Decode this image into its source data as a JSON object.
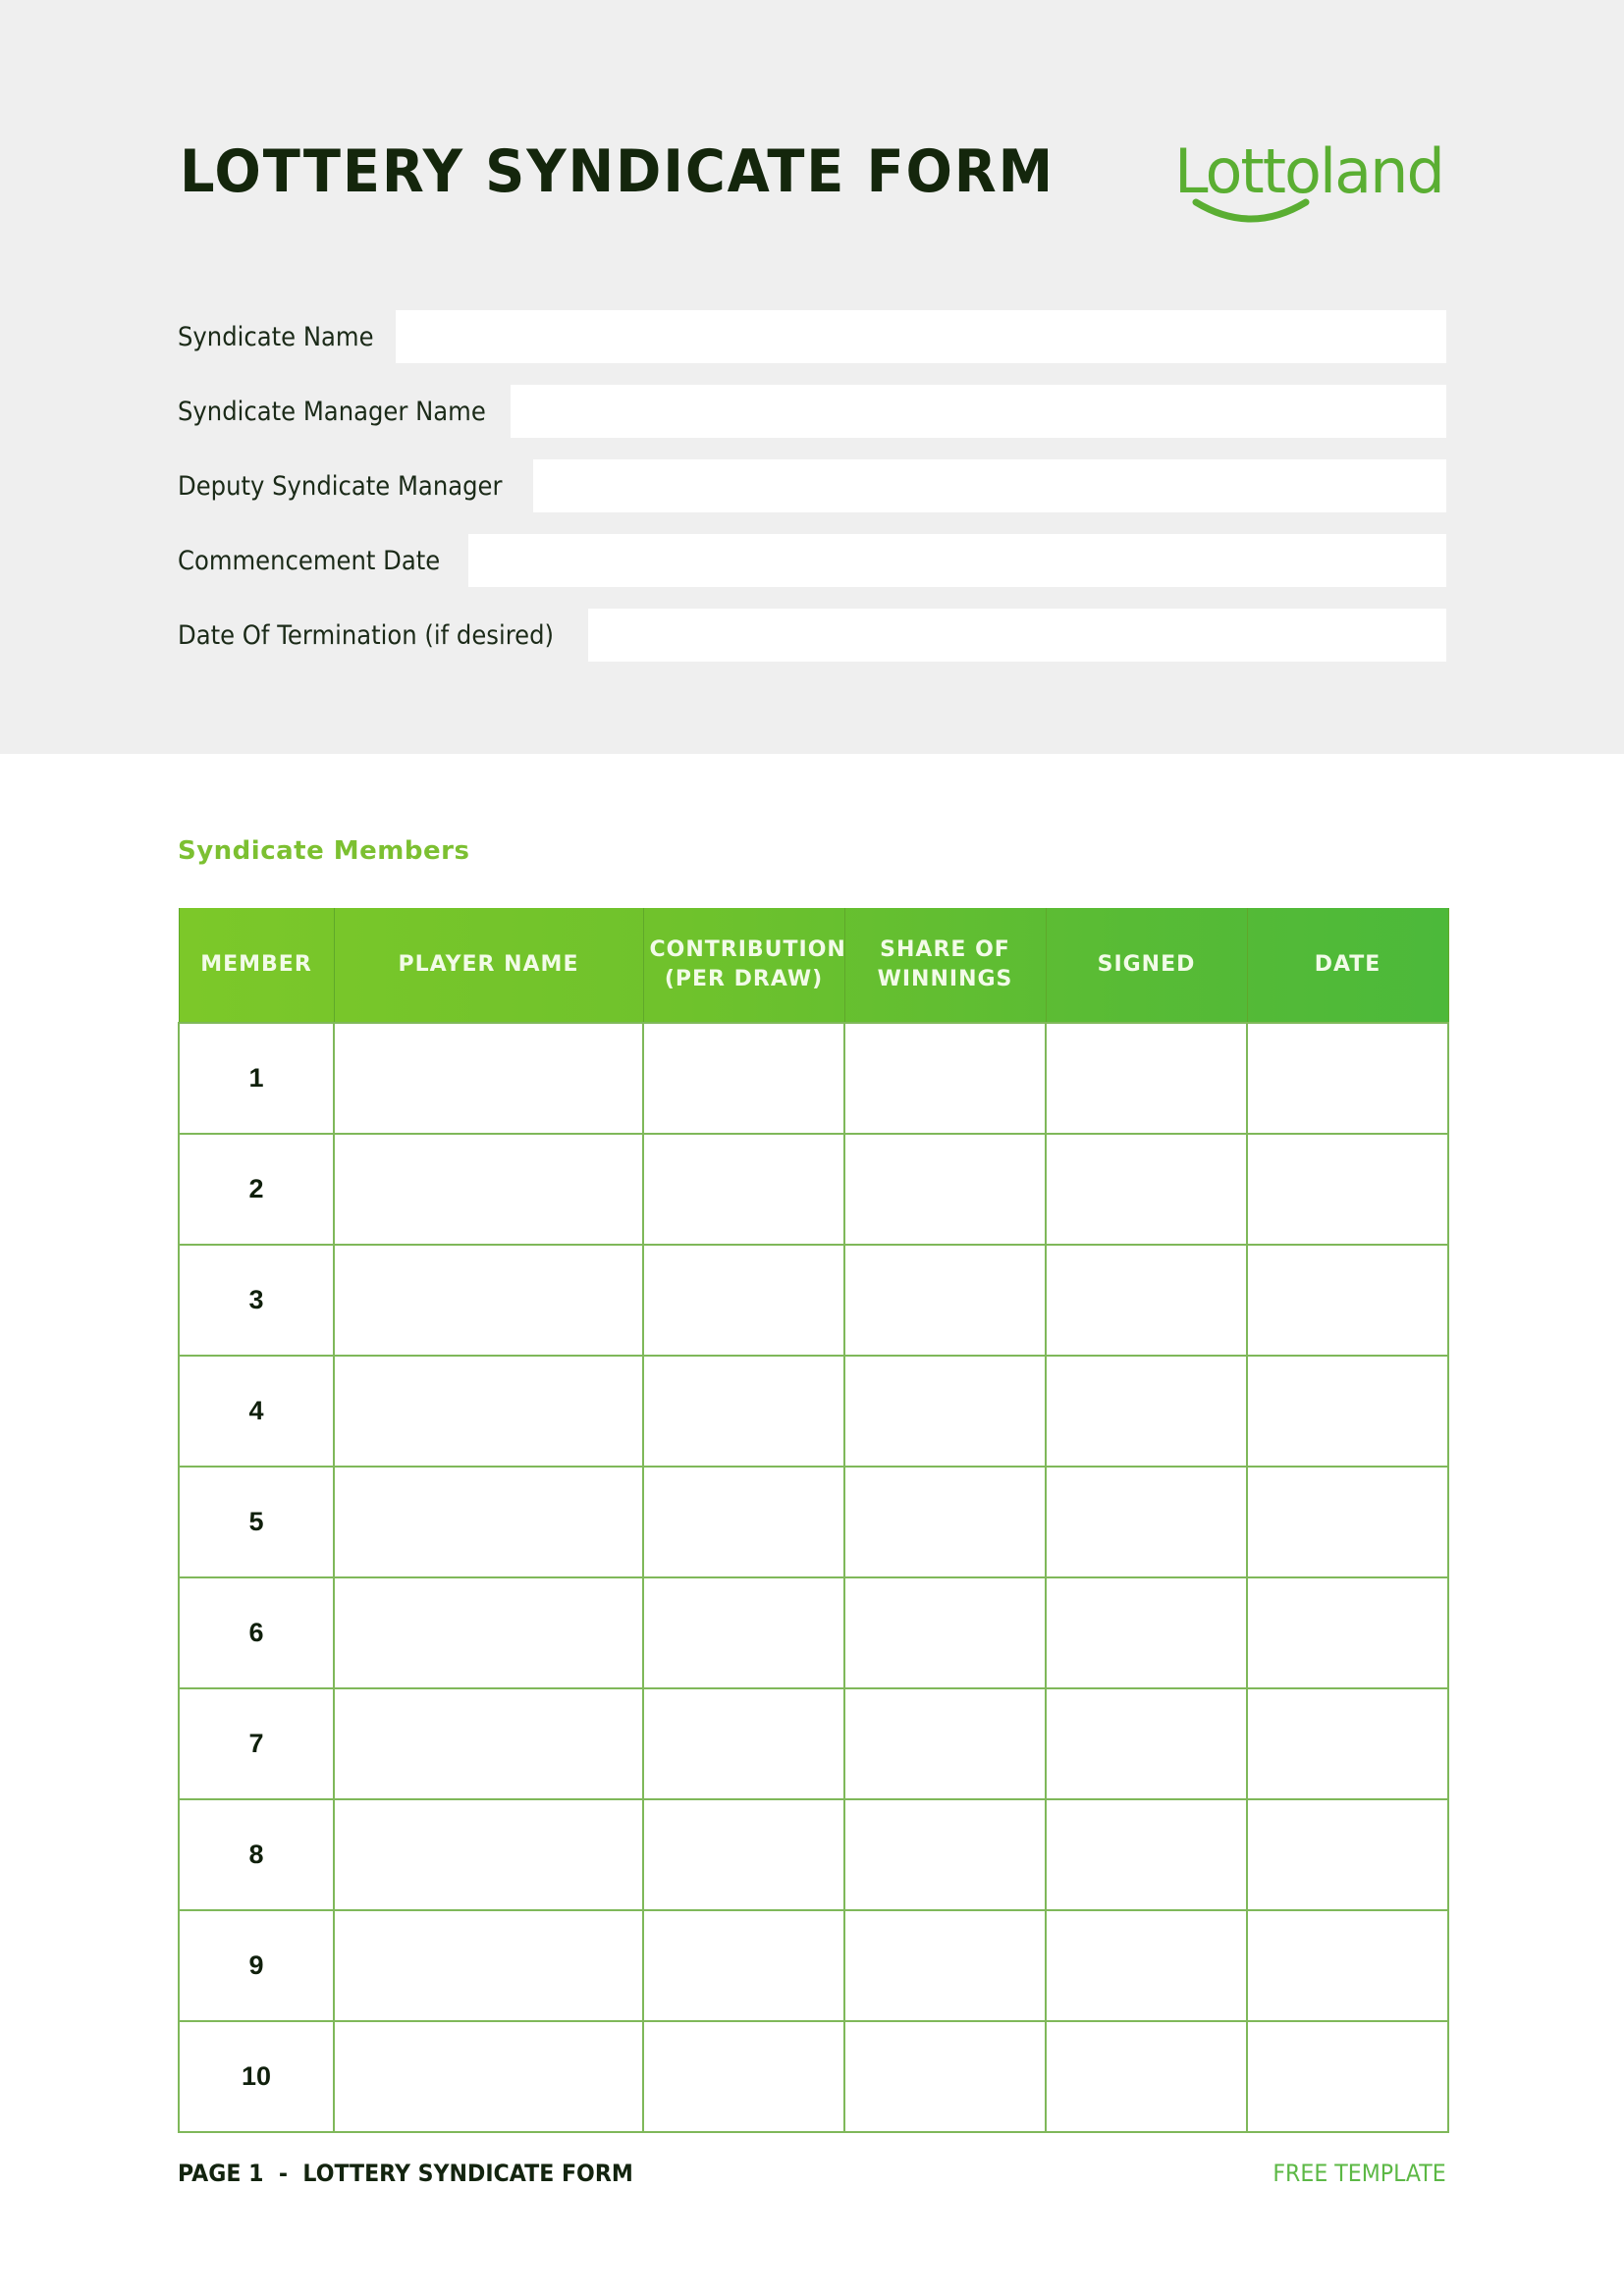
{
  "header": {
    "title": "LOTTERY SYNDICATE FORM",
    "brand": "Lottoland",
    "brand_color": "#5aae32"
  },
  "fields": [
    {
      "label": "Syndicate Name",
      "value": "",
      "placeholder": ""
    },
    {
      "label": "Syndicate Manager Name",
      "value": "",
      "placeholder": ""
    },
    {
      "label": "Deputy Syndicate Manager",
      "value": "",
      "placeholder": ""
    },
    {
      "label": "Commencement Date",
      "value": "",
      "placeholder": ""
    },
    {
      "label": "Date Of Termination (if desired)",
      "value": "",
      "placeholder": ""
    }
  ],
  "members_section": {
    "title": "Syndicate Members",
    "accent_color": "#7cc031",
    "columns": [
      "MEMBER",
      "PLAYER NAME",
      "CONTRIBUTION\n(PER DRAW)",
      "SHARE OF\nWINNINGS",
      "SIGNED",
      "DATE"
    ],
    "rows": [
      {
        "member": "1",
        "player_name": "",
        "contribution": "",
        "share": "",
        "signed": "",
        "date": ""
      },
      {
        "member": "2",
        "player_name": "",
        "contribution": "",
        "share": "",
        "signed": "",
        "date": ""
      },
      {
        "member": "3",
        "player_name": "",
        "contribution": "",
        "share": "",
        "signed": "",
        "date": ""
      },
      {
        "member": "4",
        "player_name": "",
        "contribution": "",
        "share": "",
        "signed": "",
        "date": ""
      },
      {
        "member": "5",
        "player_name": "",
        "contribution": "",
        "share": "",
        "signed": "",
        "date": ""
      },
      {
        "member": "6",
        "player_name": "",
        "contribution": "",
        "share": "",
        "signed": "",
        "date": ""
      },
      {
        "member": "7",
        "player_name": "",
        "contribution": "",
        "share": "",
        "signed": "",
        "date": ""
      },
      {
        "member": "8",
        "player_name": "",
        "contribution": "",
        "share": "",
        "signed": "",
        "date": ""
      },
      {
        "member": "9",
        "player_name": "",
        "contribution": "",
        "share": "",
        "signed": "",
        "date": ""
      },
      {
        "member": "10",
        "player_name": "",
        "contribution": "",
        "share": "",
        "signed": "",
        "date": ""
      }
    ]
  },
  "footer": {
    "page_label": "PAGE 1  -  LOTTERY SYNDICATE FORM",
    "right_label": "FREE TEMPLATE"
  }
}
